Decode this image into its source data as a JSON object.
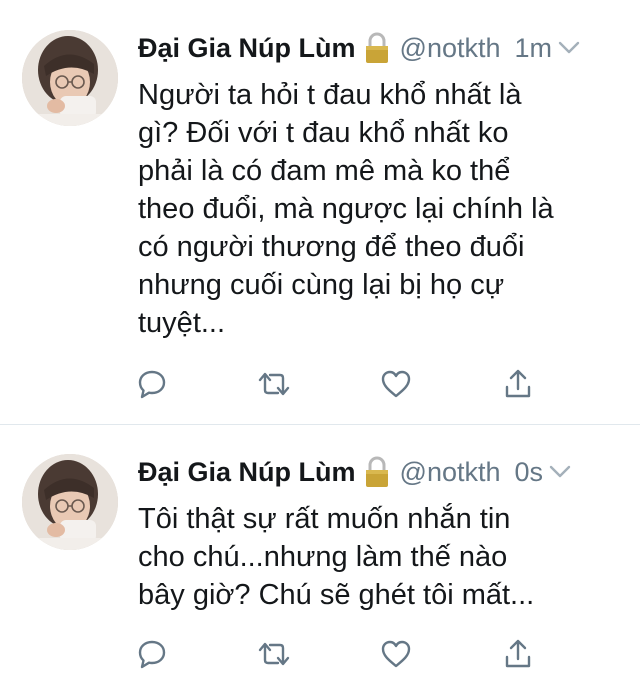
{
  "colors": {
    "name": "#14171a",
    "muted": "#657786",
    "divider": "#e1e8ed",
    "lock": "#c9a437"
  },
  "tweets": [
    {
      "display_name": "Đại Gia Núp Lùm",
      "lock_icon": "lock-icon",
      "handle": "@notkth",
      "time": "1m",
      "text": "Người ta hỏi t đau khổ nhất là\ngì? Đối với t đau khổ nhất ko\nphải là có đam mê mà ko thể\ntheo đuổi, mà ngược lại chính là\ncó người thương để theo đuổi\nnhưng cuối cùng lại bị họ cự\ntuyệt...",
      "actions": [
        "reply-icon",
        "retweet-icon",
        "heart-icon",
        "share-icon"
      ]
    },
    {
      "display_name": "Đại Gia Núp Lùm",
      "lock_icon": "lock-icon",
      "handle": "@notkth",
      "time": "0s",
      "text": "Tôi thật sự rất muốn nhắn tin\ncho chú...nhưng làm thế nào\nbây giờ? Chú sẽ ghét tôi mất...",
      "actions": [
        "reply-icon",
        "retweet-icon",
        "heart-icon",
        "share-icon"
      ]
    }
  ]
}
